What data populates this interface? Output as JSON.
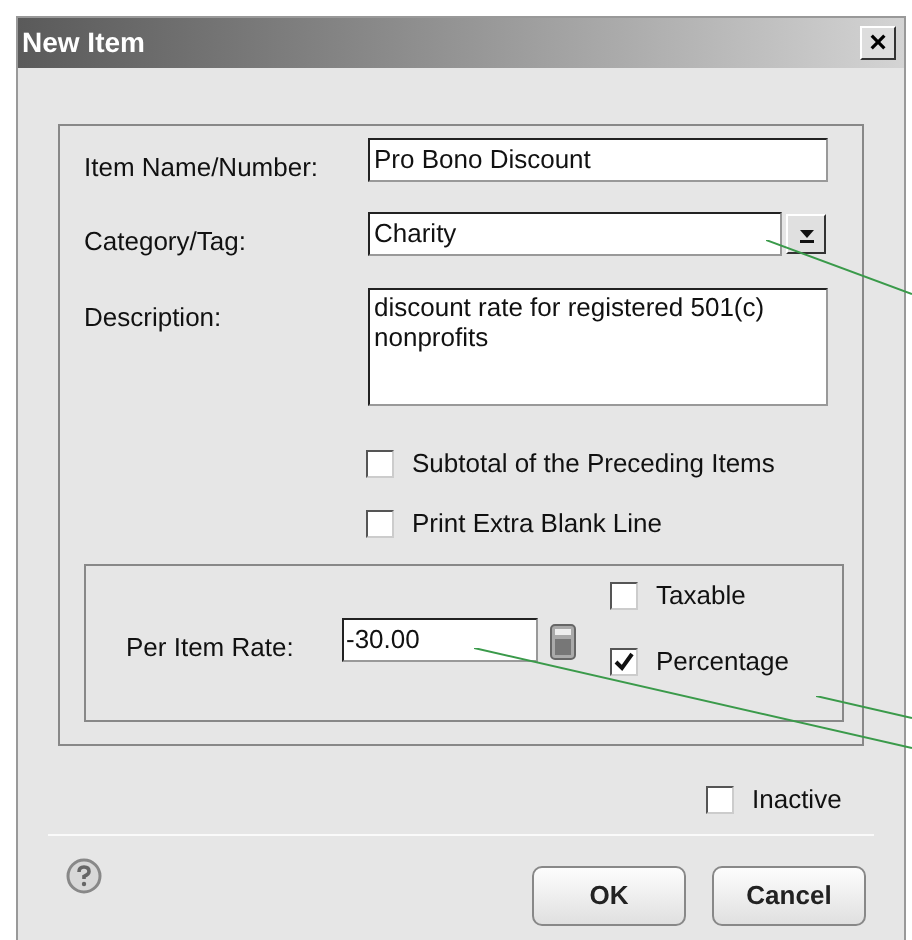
{
  "window": {
    "title": "New Item",
    "close": "×"
  },
  "fields": [
    {
      "kind": "text",
      "label": "Item Name/Number:",
      "value": "Pro Bono Discount"
    },
    {
      "kind": "dropdown",
      "label": "Category/Tag:",
      "value": "Charity"
    },
    {
      "kind": "textarea",
      "label": "Description:",
      "value": "discount rate for registered 501(c) nonprofits"
    }
  ],
  "options": [
    {
      "label": "Subtotal of the Preceding Items",
      "checked": false
    },
    {
      "label": "Print Extra Blank Line",
      "checked": false
    }
  ],
  "rate": {
    "label": "Per Item Rate:",
    "value": "-30.00",
    "checks": [
      {
        "label": "Taxable",
        "checked": false
      },
      {
        "label": "Percentage",
        "checked": true
      }
    ]
  },
  "inactive": {
    "label": "Inactive",
    "checked": false
  },
  "buttons": [
    "OK",
    "Cancel"
  ]
}
